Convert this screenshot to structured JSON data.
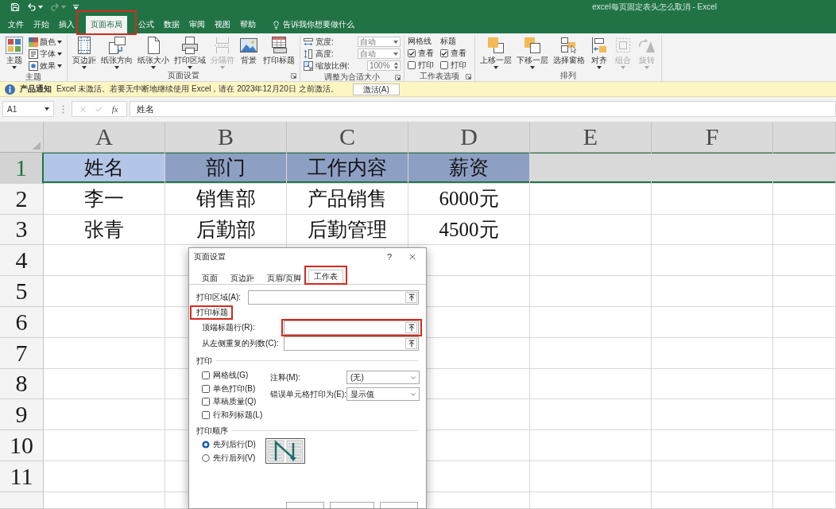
{
  "title_bar": {
    "quick_access": [
      {
        "kind": "save",
        "disabled": false,
        "dropdown": false
      },
      {
        "kind": "undo",
        "disabled": false,
        "dropdown": true
      },
      {
        "kind": "redo",
        "disabled": true,
        "dropdown": true
      },
      {
        "kind": "customize",
        "disabled": false,
        "dropdown": false
      }
    ],
    "title": "excel每页固定表头怎么取消 - Excel"
  },
  "ribbon": {
    "tabs": [
      {
        "label": "文件",
        "selected": false,
        "highlight": false
      },
      {
        "label": "开始",
        "selected": false,
        "highlight": false
      },
      {
        "label": "插入",
        "selected": false,
        "highlight": false
      },
      {
        "label": "页面布局",
        "selected": true,
        "highlight": true
      },
      {
        "label": "公式",
        "selected": false,
        "highlight": false
      },
      {
        "label": "数据",
        "selected": false,
        "highlight": false
      },
      {
        "label": "审阅",
        "selected": false,
        "highlight": false
      },
      {
        "label": "视图",
        "selected": false,
        "highlight": false
      },
      {
        "label": "帮助",
        "selected": false,
        "highlight": false
      }
    ],
    "tell_me": "告诉我你想要做什么",
    "groups": [
      {
        "label": "主题",
        "launcher": false,
        "items": [
          {
            "kind": "large",
            "label": "主题",
            "dropdown": true,
            "disabled": false
          },
          {
            "kind": "small",
            "label": "颜色",
            "dropdown": true
          },
          {
            "kind": "small",
            "label": "字体",
            "dropdown": true
          },
          {
            "kind": "small",
            "label": "效果",
            "dropdown": true
          }
        ]
      },
      {
        "label": "页面设置",
        "launcher": true,
        "items": [
          {
            "kind": "large",
            "label": "页边距",
            "dropdown": true,
            "disabled": false
          },
          {
            "kind": "large",
            "label": "纸张方向",
            "dropdown": true,
            "disabled": false
          },
          {
            "kind": "large",
            "label": "纸张大小",
            "dropdown": true,
            "disabled": false
          },
          {
            "kind": "large",
            "label": "打印区域",
            "dropdown": true,
            "disabled": false
          },
          {
            "kind": "large",
            "label": "分隔符",
            "dropdown": true,
            "disabled": true
          },
          {
            "kind": "large",
            "label": "背景",
            "dropdown": false,
            "disabled": false
          },
          {
            "kind": "large",
            "label": "打印标题",
            "dropdown": false,
            "disabled": false
          }
        ]
      },
      {
        "label": "调整为合适大小",
        "launcher": true,
        "items": [
          {
            "kind": "select",
            "label": "宽度:",
            "value": "自动"
          },
          {
            "kind": "select",
            "label": "高度:",
            "value": "自动"
          },
          {
            "kind": "spin",
            "label": "缩放比例:",
            "value": "100%"
          }
        ]
      },
      {
        "label": "工作表选项",
        "launcher": true,
        "items": [
          {
            "kind": "check_column",
            "label": "网格线",
            "checks": [
              {
                "label": "查看",
                "checked": true
              },
              {
                "label": "打印",
                "checked": false
              }
            ]
          },
          {
            "kind": "check_column",
            "label": "标题",
            "checks": [
              {
                "label": "查看",
                "checked": true
              },
              {
                "label": "打印",
                "checked": false
              }
            ]
          }
        ]
      },
      {
        "label": "排列",
        "launcher": false,
        "items": [
          {
            "kind": "large",
            "label": "上移一层",
            "dropdown": true,
            "disabled": false
          },
          {
            "kind": "large",
            "label": "下移一层",
            "dropdown": true,
            "disabled": false
          },
          {
            "kind": "large",
            "label": "选择窗格",
            "dropdown": false,
            "disabled": false
          },
          {
            "kind": "large",
            "label": "对齐",
            "dropdown": true,
            "disabled": false
          },
          {
            "kind": "large",
            "label": "组合",
            "dropdown": true,
            "disabled": true
          },
          {
            "kind": "large",
            "label": "旋转",
            "dropdown": true,
            "disabled": true
          }
        ]
      }
    ]
  },
  "info_bar": {
    "title": "产品通知",
    "message": "Excel 未激活。若要无中断地继续使用 Excel，请在 2023年12月20日 之前激活。",
    "button": "激活(A)"
  },
  "formula_bar": {
    "name_box": "A1",
    "function_button": "fx",
    "formula": "姓名"
  },
  "sheet": {
    "columns": [
      "A",
      "B",
      "C",
      "D",
      "E",
      "F"
    ],
    "rows": [
      {
        "header": "1",
        "selected": true,
        "cells": [
          {
            "text": "姓名",
            "filled": true,
            "active": true
          },
          {
            "text": "部门",
            "filled": true,
            "active": false
          },
          {
            "text": "工作内容",
            "filled": true,
            "active": false
          },
          {
            "text": "薪资",
            "filled": true,
            "active": false
          }
        ]
      },
      {
        "header": "2",
        "selected": false,
        "cells": [
          {
            "text": "李一",
            "filled": false,
            "active": false
          },
          {
            "text": "销售部",
            "filled": false,
            "active": false
          },
          {
            "text": "产品销售",
            "filled": false,
            "active": false
          },
          {
            "text": "6000元",
            "filled": false,
            "active": false
          }
        ]
      },
      {
        "header": "3",
        "selected": false,
        "cells": [
          {
            "text": "张青",
            "filled": false,
            "active": false
          },
          {
            "text": "后勤部",
            "filled": false,
            "active": false
          },
          {
            "text": "后勤管理",
            "filled": false,
            "active": false
          },
          {
            "text": "4500元",
            "filled": false,
            "active": false
          }
        ]
      },
      {
        "header": "4",
        "selected": false
      },
      {
        "header": "5",
        "selected": false
      },
      {
        "header": "6",
        "selected": false
      },
      {
        "header": "7",
        "selected": false
      },
      {
        "header": "8",
        "selected": false
      },
      {
        "header": "9",
        "selected": false
      },
      {
        "header": "10",
        "selected": false
      },
      {
        "header": "11",
        "selected": false
      }
    ]
  },
  "dialog": {
    "title": "页面设置",
    "help": "?",
    "tabs": [
      {
        "label": "页面",
        "selected": false,
        "highlight": false
      },
      {
        "label": "页边距",
        "selected": false,
        "highlight": false
      },
      {
        "label": "页眉/页脚",
        "selected": false,
        "highlight": false
      },
      {
        "label": "工作表",
        "selected": true,
        "highlight": true
      }
    ],
    "print_area": {
      "label": "打印区域(A):"
    },
    "print_titles": {
      "label": "打印标题",
      "highlight": true,
      "fields": [
        {
          "label": "顶端标题行(R):",
          "highlight": true
        },
        {
          "label": "从左侧重复的列数(C):",
          "highlight": false
        }
      ]
    },
    "print": {
      "label": "打印",
      "checks": [
        {
          "label": "网格线(G)",
          "checked": false
        },
        {
          "label": "单色打印(B)",
          "checked": false
        },
        {
          "label": "草稿质量(Q)",
          "checked": false
        },
        {
          "label": "行和列标题(L)",
          "checked": false
        }
      ],
      "selects": [
        {
          "label": "注释(M):",
          "value": "(无)"
        },
        {
          "label": "错误单元格打印为(E):",
          "value": "显示值"
        }
      ]
    },
    "page_order": {
      "label": "打印顺序",
      "options": [
        {
          "label": "先列后行(D)",
          "selected": true
        },
        {
          "label": "先行后列(V)",
          "selected": false
        }
      ]
    }
  }
}
